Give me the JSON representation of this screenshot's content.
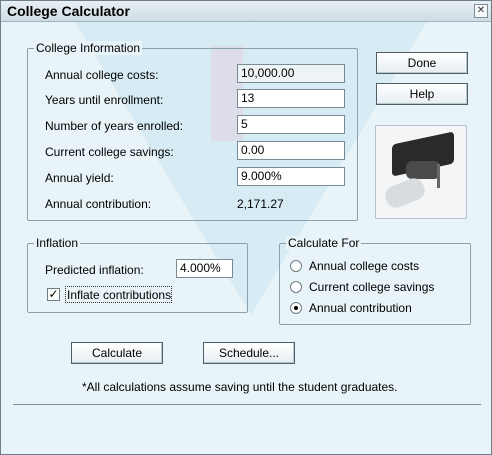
{
  "window": {
    "title": "College Calculator",
    "close_glyph": "✕"
  },
  "college_info": {
    "group_label": "College Information",
    "rows": [
      {
        "label": "Annual college costs:",
        "value": "10,000.00"
      },
      {
        "label": "Years until enrollment:",
        "value": "13"
      },
      {
        "label": "Number of years enrolled:",
        "value": "5"
      },
      {
        "label": "Current college savings:",
        "value": "0.00"
      },
      {
        "label": "Annual yield:",
        "value": "9.000%"
      },
      {
        "label": "Annual contribution:",
        "value": "2,171.27"
      }
    ]
  },
  "buttons": {
    "done": "Done",
    "help": "Help",
    "calculate": "Calculate",
    "schedule": "Schedule..."
  },
  "inflation": {
    "group_label": "Inflation",
    "predicted_label": "Predicted inflation:",
    "predicted_value": "4.000%",
    "inflate_contributions_label": "Inflate contributions",
    "inflate_contributions_checked": true
  },
  "calculate_for": {
    "group_label": "Calculate For",
    "options": [
      {
        "label": "Annual college costs",
        "selected": false
      },
      {
        "label": "Current college savings",
        "selected": false
      },
      {
        "label": "Annual contribution",
        "selected": true
      }
    ]
  },
  "note": "*All calculations assume saving until the student graduates.",
  "icons": {
    "graduation-photo": "graduation-cap-and-diploma"
  },
  "colors": {
    "background": "#e9f4f9",
    "border": "#8aa0ad"
  }
}
